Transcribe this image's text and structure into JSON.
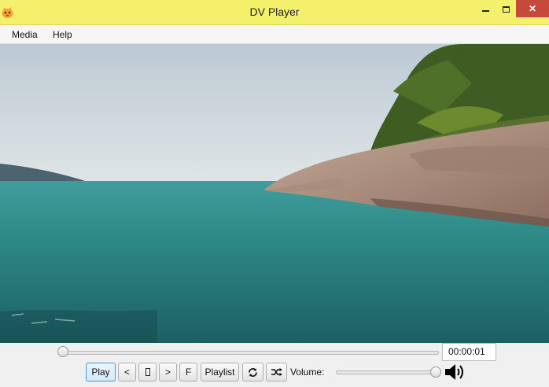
{
  "window": {
    "title": "DV Player",
    "close_glyph": "✕"
  },
  "icons": {
    "app": "app-logo-icon",
    "minimize": "minimize-icon",
    "maximize": "maximize-icon",
    "close": "close-icon",
    "stop": "stop-icon",
    "repeat": "repeat-icon",
    "shuffle": "shuffle-icon",
    "volume": "speaker-volume-icon"
  },
  "menu": {
    "items": [
      {
        "label": "Media"
      },
      {
        "label": "Help"
      }
    ]
  },
  "video": {
    "description_colors": {
      "sky": "#c9d6df",
      "sea": "#2a8a86",
      "rocks": "#b19484",
      "trees": "#3d5a1f"
    }
  },
  "seek": {
    "fraction": 0.0,
    "time": "00:00:01"
  },
  "controls": {
    "play_label": "Play",
    "prev_label": "<",
    "next_label": ">",
    "f_label": "F",
    "playlist_label": "Playlist"
  },
  "volume": {
    "label": "Volume:",
    "fraction": 0.97
  },
  "colors": {
    "titlebar": "#f4f06c",
    "close": "#c9483c",
    "accent": "#3c9ae0"
  }
}
